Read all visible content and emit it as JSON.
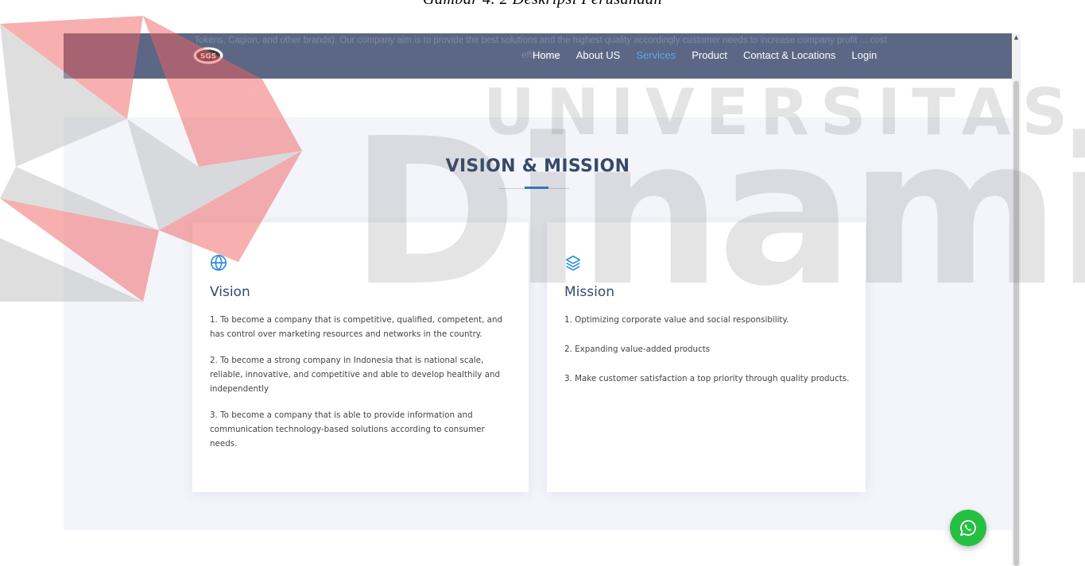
{
  "caption": "Gambar 4. 2 Deskripsi Perusahaan",
  "navbar": {
    "logo_text": "SGS",
    "ghost_text": "Tokens, Cagion, and other brands). Our company aim is to provide the best solutions and the highest quality accordingly customer needs to increase company profit ... cost efficiency",
    "items": [
      {
        "label": "Home"
      },
      {
        "label": "About US"
      },
      {
        "label": "Services"
      },
      {
        "label": "Product"
      },
      {
        "label": "Contact & Locations"
      },
      {
        "label": "Login"
      }
    ],
    "active_item": "Services",
    "background": "#5b6785",
    "active_color": "#5ba9e8"
  },
  "section": {
    "title": "VISION & MISSION",
    "vision": {
      "icon": "globe-icon",
      "title": "Vision",
      "paragraphs": [
        "1. To become a company that is competitive, qualified, competent, and has control over marketing resources and networks in the country.",
        "2. To become a strong company in Indonesia that is national scale, reliable, innovative, and competitive and able to develop healthily and independently",
        "3. To become a company that is able to provide information and communication technology-based solutions according to consumer needs."
      ]
    },
    "mission": {
      "icon": "layers-icon",
      "title": "Mission",
      "paragraphs": [
        "1. Optimizing corporate value and social responsibility.",
        "2. Expanding value-added products",
        "3. Make customer satisfaction a top priority through quality products."
      ]
    }
  },
  "watermark": {
    "top_word": "UNIVERSITAS",
    "main_word": "Dinamika"
  },
  "floating": {
    "icon": "whatsapp-icon",
    "color": "#25c041"
  }
}
